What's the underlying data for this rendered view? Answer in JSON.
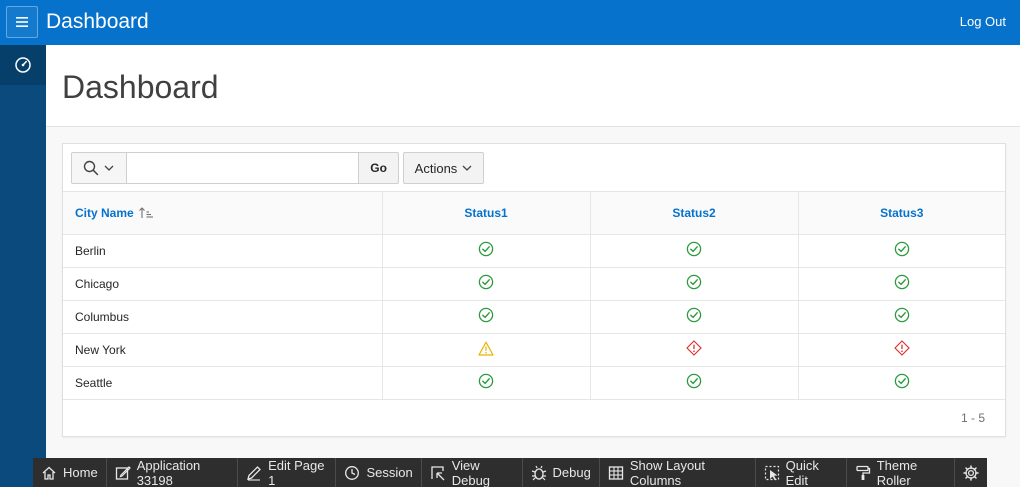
{
  "header": {
    "app_title": "Dashboard",
    "logout_label": "Log Out",
    "menu_icon": "hamburger-menu-icon"
  },
  "sidebar": {
    "items": [
      {
        "icon": "speedometer-icon",
        "active": true
      }
    ]
  },
  "page": {
    "title": "Dashboard"
  },
  "report": {
    "search": {
      "value": "",
      "placeholder": ""
    },
    "go_label": "Go",
    "actions_label": "Actions",
    "columns": [
      "City Name",
      "Status1",
      "Status2",
      "Status3"
    ],
    "sort": {
      "column": "City Name",
      "direction": "ascending"
    },
    "rows": [
      {
        "city": "Berlin",
        "status1": "ok",
        "status2": "ok",
        "status3": "ok"
      },
      {
        "city": "Chicago",
        "status1": "ok",
        "status2": "ok",
        "status3": "ok"
      },
      {
        "city": "Columbus",
        "status1": "ok",
        "status2": "ok",
        "status3": "ok"
      },
      {
        "city": "New York",
        "status1": "warning",
        "status2": "error",
        "status3": "error"
      },
      {
        "city": "Seattle",
        "status1": "ok",
        "status2": "ok",
        "status3": "ok"
      }
    ],
    "pagination": "1 - 5"
  },
  "status_colors": {
    "ok": "#2b9a3e",
    "warning": "#e8b400",
    "error": "#e0302c"
  },
  "developer_toolbar": {
    "items": [
      {
        "label": "Home",
        "icon": "home-icon"
      },
      {
        "label": "Application 33198",
        "icon": "edit-icon"
      },
      {
        "label": "Edit Page 1",
        "icon": "pencil-icon"
      },
      {
        "label": "Session",
        "icon": "clock-icon"
      },
      {
        "label": "View Debug",
        "icon": "view-debug-icon"
      },
      {
        "label": "Debug",
        "icon": "bug-icon"
      },
      {
        "label": "Show Layout Columns",
        "icon": "grid-icon"
      },
      {
        "label": "Quick Edit",
        "icon": "quick-edit-icon"
      },
      {
        "label": "Theme Roller",
        "icon": "paint-roller-icon"
      },
      {
        "label": "",
        "icon": "gear-icon"
      }
    ]
  }
}
